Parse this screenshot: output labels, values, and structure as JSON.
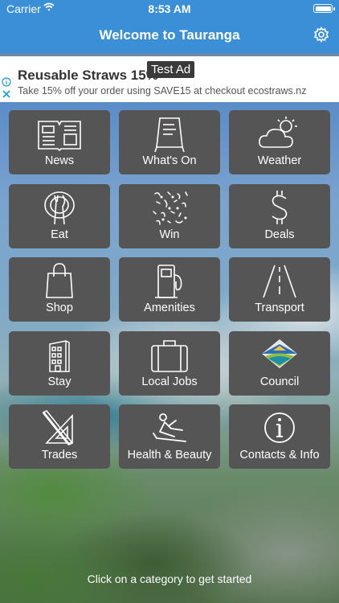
{
  "status_bar": {
    "carrier": "Carrier",
    "time": "8:53 AM"
  },
  "nav": {
    "title": "Welcome to Tauranga",
    "settings_icon": "gear-icon"
  },
  "ad": {
    "headline": "Reusable Straws 15%",
    "badge": "Test Ad",
    "body": "Take 15% off your order using SAVE15 at checkout",
    "domain": "ecostraws.nz",
    "info_icon": "info-icon",
    "close_icon": "close-icon"
  },
  "tiles": [
    {
      "label": "News",
      "icon": "newspaper-icon"
    },
    {
      "label": "What's On",
      "icon": "easel-board-icon"
    },
    {
      "label": "Weather",
      "icon": "cloud-sun-icon"
    },
    {
      "label": "Eat",
      "icon": "plate-cutlery-icon"
    },
    {
      "label": "Win",
      "icon": "confetti-icon"
    },
    {
      "label": "Deals",
      "icon": "dollar-icon"
    },
    {
      "label": "Shop",
      "icon": "shopping-bag-icon"
    },
    {
      "label": "Amenities",
      "icon": "fuel-pump-icon"
    },
    {
      "label": "Transport",
      "icon": "road-icon"
    },
    {
      "label": "Stay",
      "icon": "hotel-building-icon"
    },
    {
      "label": "Local Jobs",
      "icon": "briefcase-icon"
    },
    {
      "label": "Council",
      "icon": "council-logo-icon"
    },
    {
      "label": "Trades",
      "icon": "set-square-ruler-icon"
    },
    {
      "label": "Health & Beauty",
      "icon": "massage-person-icon"
    },
    {
      "label": "Contacts & Info",
      "icon": "info-circle-icon"
    }
  ],
  "footer": {
    "hint": "Click on a category to get started"
  },
  "colors": {
    "bar": "#3b8fd6",
    "tile": "#555555"
  }
}
